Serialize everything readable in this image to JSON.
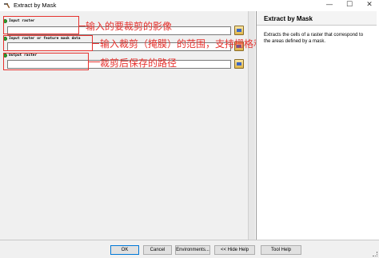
{
  "window": {
    "title": "Extract by Mask",
    "minimize_glyph": "—",
    "maximize_glyph": "☐",
    "close_glyph": "✕"
  },
  "params": [
    {
      "label": "Input raster",
      "icon": "folder-icon"
    },
    {
      "label": "Input raster or feature mask data",
      "icon": "folder-icon"
    },
    {
      "label": "Output raster",
      "icon": "folder-icon"
    }
  ],
  "annotations": [
    "输入的要裁剪的影像",
    "输入裁剪（掩膜）的范围，支持栅格和矢量",
    "裁剪后保存的路径"
  ],
  "help": {
    "title": "Extract by Mask",
    "body": "Extracts the cells of a raster that correspond to the areas defined by a mask."
  },
  "buttons": {
    "ok": "OK",
    "cancel": "Cancel",
    "environments": "Environments...",
    "hide_help": "<< Hide Help",
    "tool_help": "Tool Help"
  },
  "colors": {
    "annotation": "#e6322e",
    "required_dot": "#2ca02c"
  }
}
